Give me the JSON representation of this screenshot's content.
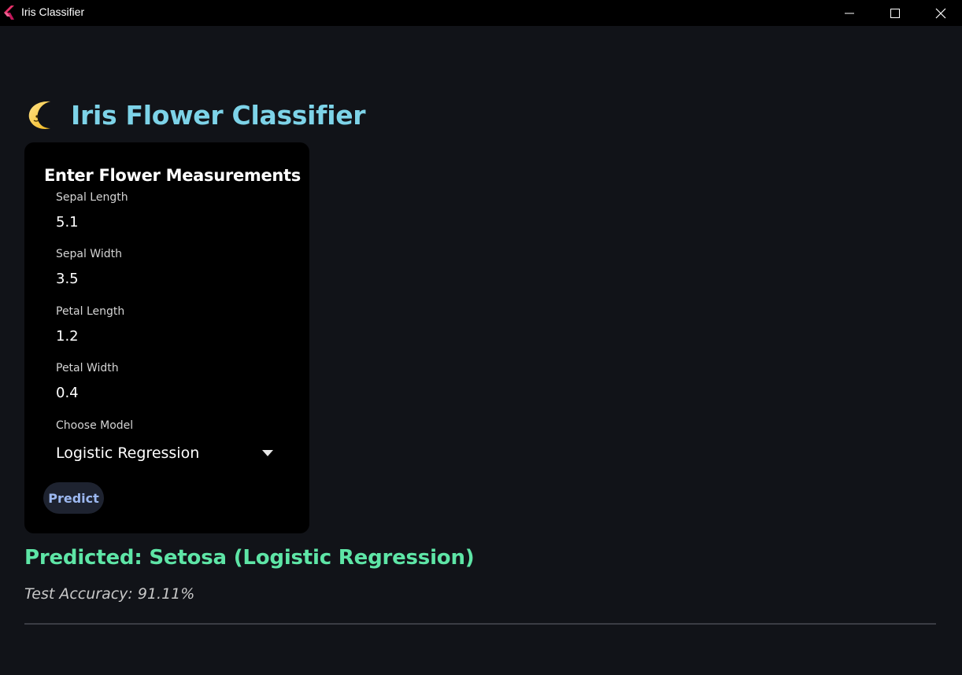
{
  "window": {
    "title": "Iris Classifier",
    "icon": "flutter-logo-icon"
  },
  "header": {
    "emoji": "crescent-moon-icon",
    "title": "Iris Flower Classifier"
  },
  "form": {
    "title": "Enter Flower Measurements",
    "fields": [
      {
        "label": "Sepal Length",
        "value": "5.1"
      },
      {
        "label": "Sepal Width",
        "value": "3.5"
      },
      {
        "label": "Petal Length",
        "value": "1.2"
      },
      {
        "label": "Petal Width",
        "value": "0.4"
      }
    ],
    "model": {
      "label": "Choose Model",
      "selected": "Logistic Regression"
    },
    "predict_label": "Predict"
  },
  "result": {
    "prediction": "Predicted: Setosa (Logistic Regression)",
    "accuracy": "Test Accuracy: 91.11%"
  },
  "colors": {
    "background": "#111318",
    "card": "#000000",
    "heading": "#7dd3e8",
    "prediction": "#5ee5a6",
    "button_text": "#9cb8f0"
  }
}
